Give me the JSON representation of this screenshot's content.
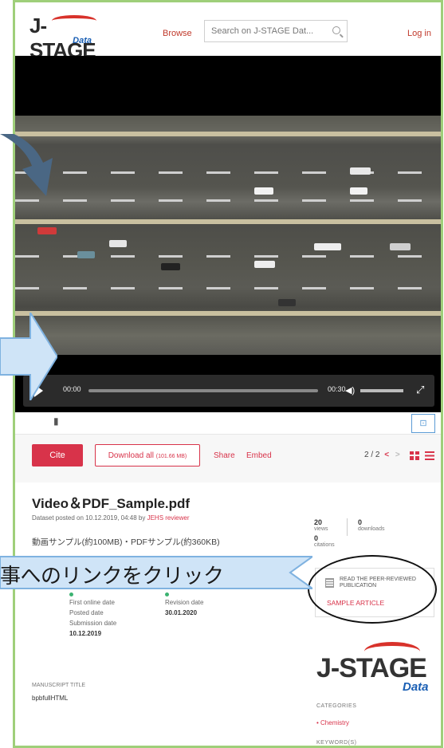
{
  "header": {
    "logo": "J-STAGE",
    "logo_sub": "Data",
    "browse": "Browse",
    "search_placeholder": "Search on J-STAGE Dat...",
    "login": "Log in"
  },
  "video": {
    "time_current": "00:00",
    "time_total": "00:30",
    "progress": 0
  },
  "actions": {
    "cite": "Cite",
    "download_all": "Download all",
    "download_size": "(101.66 MB)",
    "share": "Share",
    "embed": "Embed",
    "pager": "2 / 2"
  },
  "dataset": {
    "title": "Video＆PDF_Sample.pdf",
    "posted_prefix": "Dataset posted on 10.12.2019, 04:48 by",
    "author": "JEHS reviewer",
    "description": "動画サンプル(約100MB)・PDFサンプル(約360KB)",
    "views_count": "20",
    "views_label": "views",
    "downloads_count": "0",
    "downloads_label": "downloads",
    "citations_count": "0",
    "citations_label": "citations"
  },
  "dates": {
    "first_online_label": "First online date",
    "revision_label": "Revision date",
    "revision_value": "30.01.2020",
    "posted_label": "Posted date",
    "submission_label": "Submission date",
    "submission_value": "10.12.2019"
  },
  "manuscript": {
    "label": "MANUSCRIPT TITLE",
    "value": "bpbfullHTML"
  },
  "peer_review": {
    "title": "READ THE PEER-REVIEWED PUBLICATION",
    "link": "SAMPLE ARTICLE"
  },
  "sidebar": {
    "logo": "J-STAGE",
    "logo_sub": "Data",
    "categories_label": "CATEGORIES",
    "category": "• Chemistry",
    "keywords_label": "KEYWORD(S)"
  },
  "callout": {
    "text": "事へのリンクをクリック"
  },
  "colors": {
    "accent": "#d8334a",
    "frame": "#9fcf7a",
    "callout_fill": "#cfe4f7",
    "arrow_dark": "#4a6784"
  }
}
